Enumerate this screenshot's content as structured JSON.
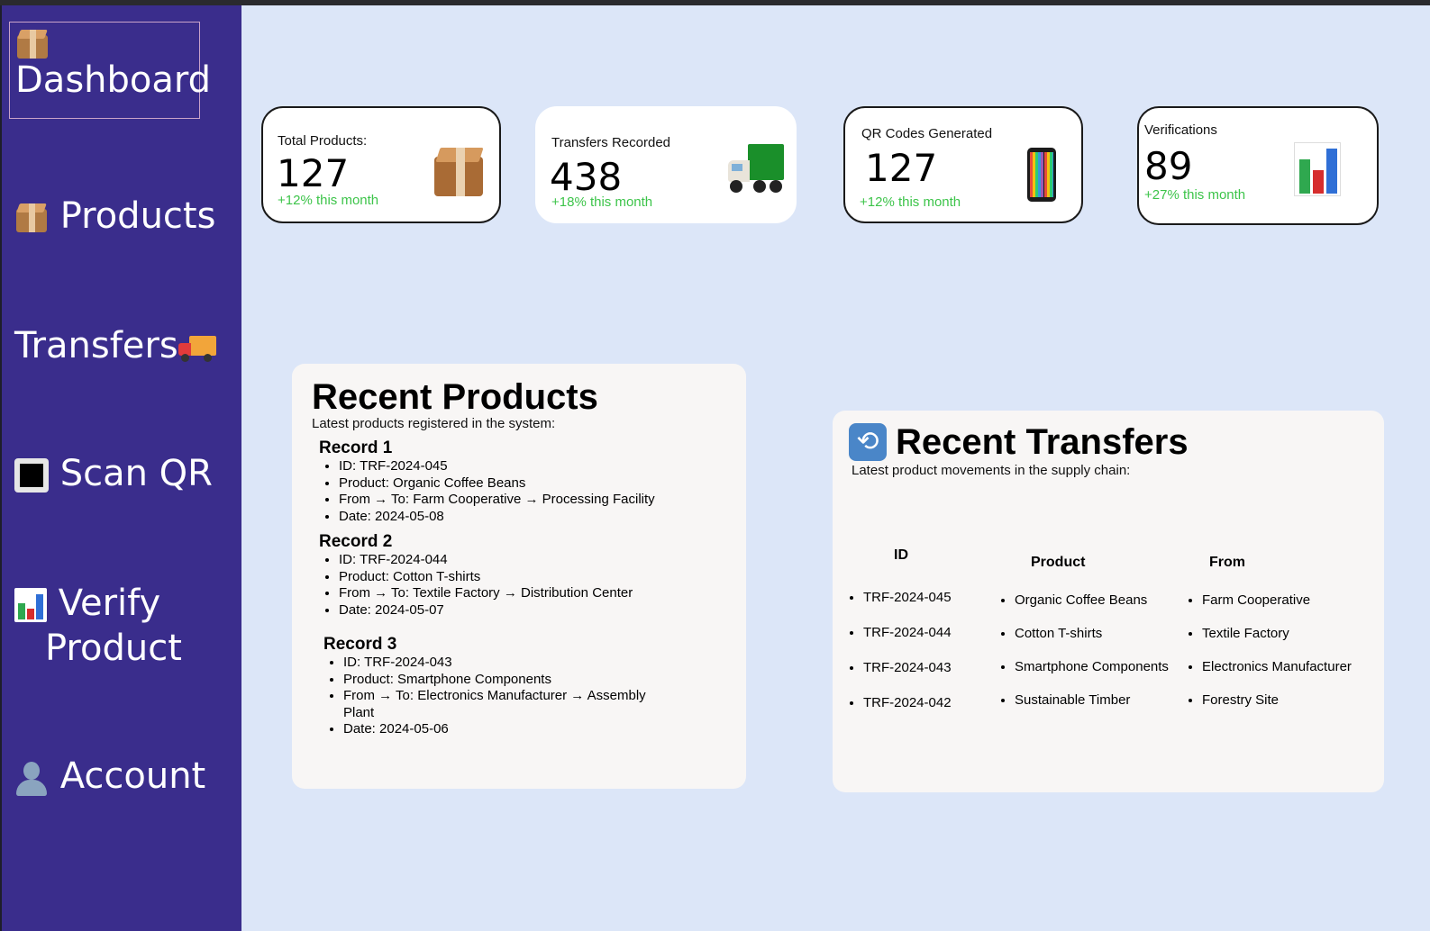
{
  "sidebar": {
    "items": [
      {
        "label": "Dashboard",
        "icon": "package-icon"
      },
      {
        "label": "Products",
        "icon": "package-icon"
      },
      {
        "label": "Transfers",
        "icon": "truck-icon"
      },
      {
        "label": "Scan QR",
        "icon": "black-square-icon"
      },
      {
        "label": "Verify",
        "label2": "Product",
        "icon": "bar-chart-icon"
      },
      {
        "label": "Account",
        "icon": "user-icon"
      }
    ]
  },
  "stats": [
    {
      "label": "Total Products:",
      "value": "127",
      "change": "+12% this month",
      "icon": "package-icon"
    },
    {
      "label": "Transfers Recorded",
      "value": "438",
      "change": "+18% this month",
      "icon": "truck-icon"
    },
    {
      "label": "QR Codes Generated",
      "value": "127",
      "change": "+12% this month",
      "icon": "mobile-phone-icon"
    },
    {
      "label": "Verifications",
      "value": "89",
      "change": "+27% this month",
      "icon": "bar-chart-icon"
    }
  ],
  "recent_products": {
    "title": "Recent Products",
    "subtitle": "Latest products registered in the system:",
    "records": [
      {
        "title": "Record 1",
        "lines": [
          "ID: TRF-2024-045",
          "Product: Organic Coffee Beans",
          "From → To: Farm Cooperative → Processing Facility",
          "Date: 2024-05-08"
        ]
      },
      {
        "title": "Record 2",
        "lines": [
          "ID: TRF-2024-044",
          "Product: Cotton T-shirts",
          "From → To: Textile Factory → Distribution Center",
          "Date: 2024-05-07"
        ]
      },
      {
        "title": "Record 3",
        "lines": [
          "ID: TRF-2024-043",
          "Product: Smartphone Components",
          "From → To: Electronics Manufacturer → Assembly Plant",
          "Date: 2024-05-06"
        ]
      }
    ]
  },
  "recent_transfers": {
    "title": "Recent Transfers",
    "subtitle": "Latest product movements in the supply chain:",
    "columns": {
      "id": {
        "header": "ID",
        "items": [
          "TRF-2024-045",
          "TRF-2024-044",
          "TRF-2024-043",
          "TRF-2024-042"
        ]
      },
      "product": {
        "header": "Product",
        "items": [
          "Organic Coffee Beans",
          "Cotton T-shirts",
          "Smartphone Components",
          "Sustainable Timber"
        ]
      },
      "from": {
        "header": "From",
        "items": [
          "Farm Cooperative",
          "Textile Factory",
          "Electronics Manufacturer",
          "Forestry Site"
        ]
      }
    }
  },
  "colors": {
    "sidebar": "#3a2d8c",
    "background": "#dce6f8",
    "positive": "#3dc44a"
  }
}
